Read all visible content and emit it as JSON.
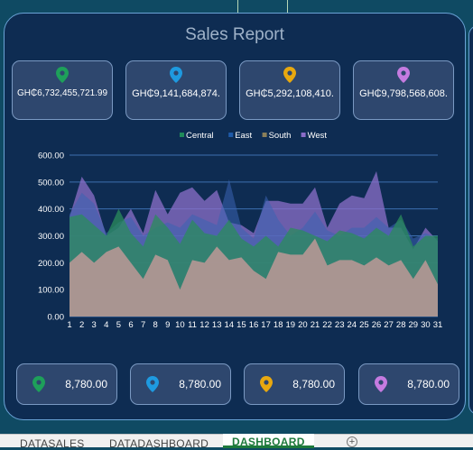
{
  "report": {
    "title": "Sales Report",
    "top_cards": [
      {
        "region_color": "#1ea05a",
        "value": "GH₵6,732,455,721.99"
      },
      {
        "region_color": "#1e9ae0",
        "value": "GH₵9,141,684,874."
      },
      {
        "region_color": "#e8a80f",
        "value": "GH₵5,292,108,410."
      },
      {
        "region_color": "#c57be0",
        "value": "GH₵9,798,568,608."
      }
    ],
    "bottom_cards": [
      {
        "region_color": "#1ea05a",
        "value": "8,780.00"
      },
      {
        "region_color": "#1e9ae0",
        "value": "8,780.00"
      },
      {
        "region_color": "#e8a80f",
        "value": "8,780.00"
      },
      {
        "region_color": "#c57be0",
        "value": "8,780.00"
      }
    ]
  },
  "sheet_tabs": {
    "tabs": [
      "DATASALES",
      "DATADASHBOARD",
      "DASHBOARD"
    ],
    "active": "DASHBOARD",
    "add_icon": "plus-circle-icon"
  },
  "chart_data": {
    "type": "area",
    "categories": [
      "1",
      "2",
      "3",
      "4",
      "5",
      "6",
      "7",
      "8",
      "9",
      "10",
      "11",
      "12",
      "13",
      "14",
      "15",
      "16",
      "17",
      "18",
      "19",
      "20",
      "21",
      "22",
      "23",
      "24",
      "25",
      "26",
      "27",
      "28",
      "29",
      "30",
      "31"
    ],
    "ylim": [
      0,
      600
    ],
    "yticks": [
      "0.00",
      "100.00",
      "200.00",
      "300.00",
      "400.00",
      "500.00",
      "600.00"
    ],
    "grid": true,
    "legend_position": "top",
    "series": [
      {
        "name": "Central",
        "color": "#1f8a5a",
        "values": [
          370,
          380,
          340,
          300,
          400,
          310,
          260,
          380,
          330,
          270,
          360,
          310,
          300,
          360,
          290,
          260,
          300,
          260,
          330,
          320,
          300,
          280,
          320,
          310,
          290,
          330,
          300,
          380,
          260,
          300,
          300
        ]
      },
      {
        "name": "East",
        "color": "#1e5aa8",
        "values": [
          380,
          460,
          420,
          310,
          350,
          370,
          300,
          330,
          350,
          330,
          380,
          360,
          340,
          510,
          330,
          290,
          450,
          360,
          300,
          330,
          390,
          320,
          300,
          330,
          330,
          370,
          330,
          360,
          290,
          310,
          290
        ]
      },
      {
        "name": "South",
        "color": "#8a7f5a",
        "values": [
          200,
          240,
          200,
          240,
          260,
          200,
          140,
          230,
          210,
          100,
          210,
          200,
          260,
          210,
          220,
          170,
          140,
          240,
          230,
          230,
          290,
          190,
          210,
          210,
          190,
          220,
          190,
          210,
          140,
          210,
          120
        ]
      },
      {
        "name": "West",
        "color": "#8a6cc8",
        "values": [
          370,
          520,
          450,
          300,
          330,
          400,
          310,
          470,
          380,
          460,
          480,
          430,
          470,
          350,
          340,
          310,
          430,
          430,
          420,
          420,
          480,
          330,
          420,
          450,
          440,
          540,
          330,
          330,
          250,
          330,
          280
        ]
      }
    ]
  }
}
